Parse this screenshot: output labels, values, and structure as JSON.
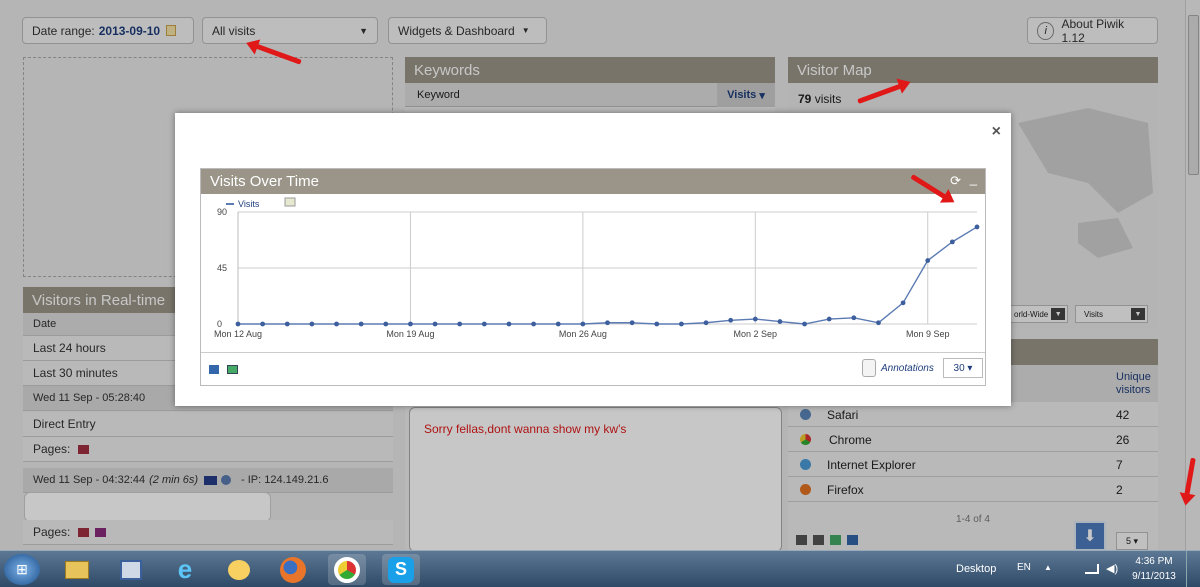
{
  "colors": {
    "accent": "#1f3e7c",
    "panel_title": "#9a9588",
    "line": "#5b7bb3",
    "annotation": "#e01818",
    "taskbar": "#3d5a78"
  },
  "topbar": {
    "date_range_label": "Date range:",
    "date_value": "2013-09-10",
    "visits_select": "All visits",
    "widgets_menu": "Widgets & Dashboard",
    "about": "About Piwik 1.12"
  },
  "keywords": {
    "title": "Keywords",
    "col_keyword": "Keyword",
    "col_visits": "Visits"
  },
  "visitor_map": {
    "title": "Visitor Map",
    "count": "79",
    "count_label": "visits",
    "region_select": "orld-Wide",
    "metric_select": "Visits"
  },
  "realtime": {
    "title": "Visitors in Real-time",
    "col_date": "Date",
    "rows": [
      "Last 24 hours",
      "Last 30 minutes"
    ],
    "visit1": "Wed 11 Sep - 05:28:40",
    "referrer": "Direct Entry",
    "pages": "Pages:",
    "visit2_time": "Wed 11 Sep - 04:32:44",
    "visit2_dur": "(2 min 6s)",
    "visit2_ip": "- IP: 124.149.21.6"
  },
  "browsers": {
    "col_unique": "Unique visitors",
    "items": [
      {
        "name": "Safari",
        "value": "42"
      },
      {
        "name": "Chrome",
        "value": "26"
      },
      {
        "name": "Internet Explorer",
        "value": "7"
      },
      {
        "name": "Firefox",
        "value": "2"
      }
    ],
    "pager": "1-4 of 4",
    "limit": "5"
  },
  "note": "Sorry fellas,dont wanna show my kw's",
  "modal": {
    "close": "×",
    "widget_title": "Visits Over Time",
    "legend": "Visits",
    "annotations": "Annotations",
    "period_limit": "30"
  },
  "chart_data": {
    "type": "line",
    "title": "Visits Over Time",
    "series": [
      {
        "name": "Visits",
        "values": [
          0,
          0,
          0,
          0,
          0,
          0,
          0,
          0,
          0,
          0,
          0,
          0,
          0,
          0,
          0,
          1,
          1,
          0,
          0,
          1,
          3,
          4,
          2,
          0,
          4,
          5,
          1,
          17,
          51,
          66,
          78
        ]
      }
    ],
    "y_ticks": [
      "0",
      "45",
      "90"
    ],
    "ylim": [
      0,
      90
    ],
    "x_tick_labels": [
      "Mon 12 Aug",
      "Mon 19 Aug",
      "Mon 26 Aug",
      "Mon 2 Sep",
      "Mon 9 Sep"
    ],
    "x_tick_index": [
      0,
      7,
      14,
      21,
      28
    ],
    "grid": true,
    "legend": "top-left"
  },
  "taskbar": {
    "desktop": "Desktop",
    "lang": "EN",
    "time": "4:36 PM",
    "date": "9/11/2013"
  }
}
